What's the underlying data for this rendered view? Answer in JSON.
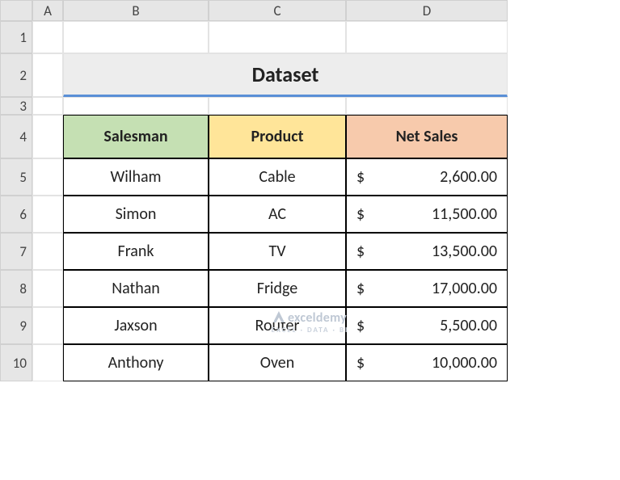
{
  "columns": [
    "A",
    "B",
    "C",
    "D"
  ],
  "rows": [
    "1",
    "2",
    "3",
    "4",
    "5",
    "6",
    "7",
    "8",
    "9",
    "10"
  ],
  "title": "Dataset",
  "headers": {
    "salesman": "Salesman",
    "product": "Product",
    "netsales": "Net Sales"
  },
  "currency_symbol": "$",
  "chart_data": {
    "type": "table",
    "columns": [
      "Salesman",
      "Product",
      "Net Sales"
    ],
    "rows": [
      {
        "salesman": "Wilham",
        "product": "Cable",
        "net_sales": "2,600.00"
      },
      {
        "salesman": "Simon",
        "product": "AC",
        "net_sales": "11,500.00"
      },
      {
        "salesman": "Frank",
        "product": "TV",
        "net_sales": "13,500.00"
      },
      {
        "salesman": "Nathan",
        "product": "Fridge",
        "net_sales": "17,000.00"
      },
      {
        "salesman": "Jaxson",
        "product": "Router",
        "net_sales": "5,500.00"
      },
      {
        "salesman": "Anthony",
        "product": "Oven",
        "net_sales": "10,000.00"
      }
    ]
  },
  "watermark": {
    "name": "exceldemy",
    "tag": "EXCEL · DATA · BI"
  }
}
